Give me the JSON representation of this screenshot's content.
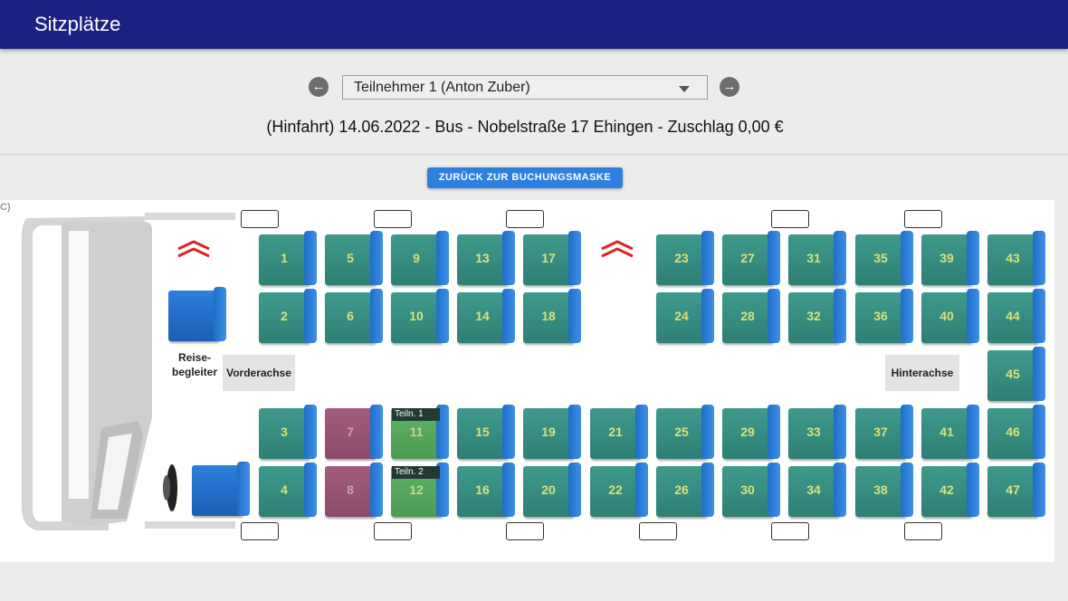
{
  "header": {
    "title": "Sitzplätze"
  },
  "selector": {
    "prev_icon": "arrow-left-icon",
    "next_icon": "arrow-right-icon",
    "selected": "Teilnehmer 1 (Anton Zuber)"
  },
  "trip": {
    "text": "(Hinfahrt) 14.06.2022 - Bus - Nobelstraße 17 Ehingen - Zuschlag 0,00 €"
  },
  "back_button": {
    "label": "ZURÜCK ZUR BUCHUNGSMASKE"
  },
  "bus": {
    "corner_label": "C)",
    "guide_label_1": "Reise-",
    "guide_label_2": "begleiter",
    "front_axle": "Vorderachse",
    "rear_axle": "Hinterachse",
    "seats": {
      "s1": "1",
      "s2": "2",
      "s3": "3",
      "s4": "4",
      "s5": "5",
      "s6": "6",
      "s7": "7",
      "s8": "8",
      "s9": "9",
      "s10": "10",
      "s11": "11",
      "s12": "12",
      "s13": "13",
      "s14": "14",
      "s15": "15",
      "s16": "16",
      "s17": "17",
      "s18": "18",
      "s19": "19",
      "s20": "20",
      "s21": "21",
      "s22": "22",
      "s23": "23",
      "s24": "24",
      "s25": "25",
      "s26": "26",
      "s27": "27",
      "s28": "28",
      "s29": "29",
      "s30": "30",
      "s31": "31",
      "s32": "32",
      "s33": "33",
      "s34": "34",
      "s35": "35",
      "s36": "36",
      "s37": "37",
      "s38": "38",
      "s39": "39",
      "s40": "40",
      "s41": "41",
      "s42": "42",
      "s43": "43",
      "s44": "44",
      "s45": "45",
      "s46": "46",
      "s47": "47"
    },
    "tags": {
      "t11": "Teiln. 1",
      "t12": "Teiln. 2"
    },
    "colors": {
      "available": "#3a9485",
      "occupied": "#9a5677",
      "selected": "#58a85d",
      "header": "#1b2284",
      "button": "#2d7fe0"
    }
  }
}
